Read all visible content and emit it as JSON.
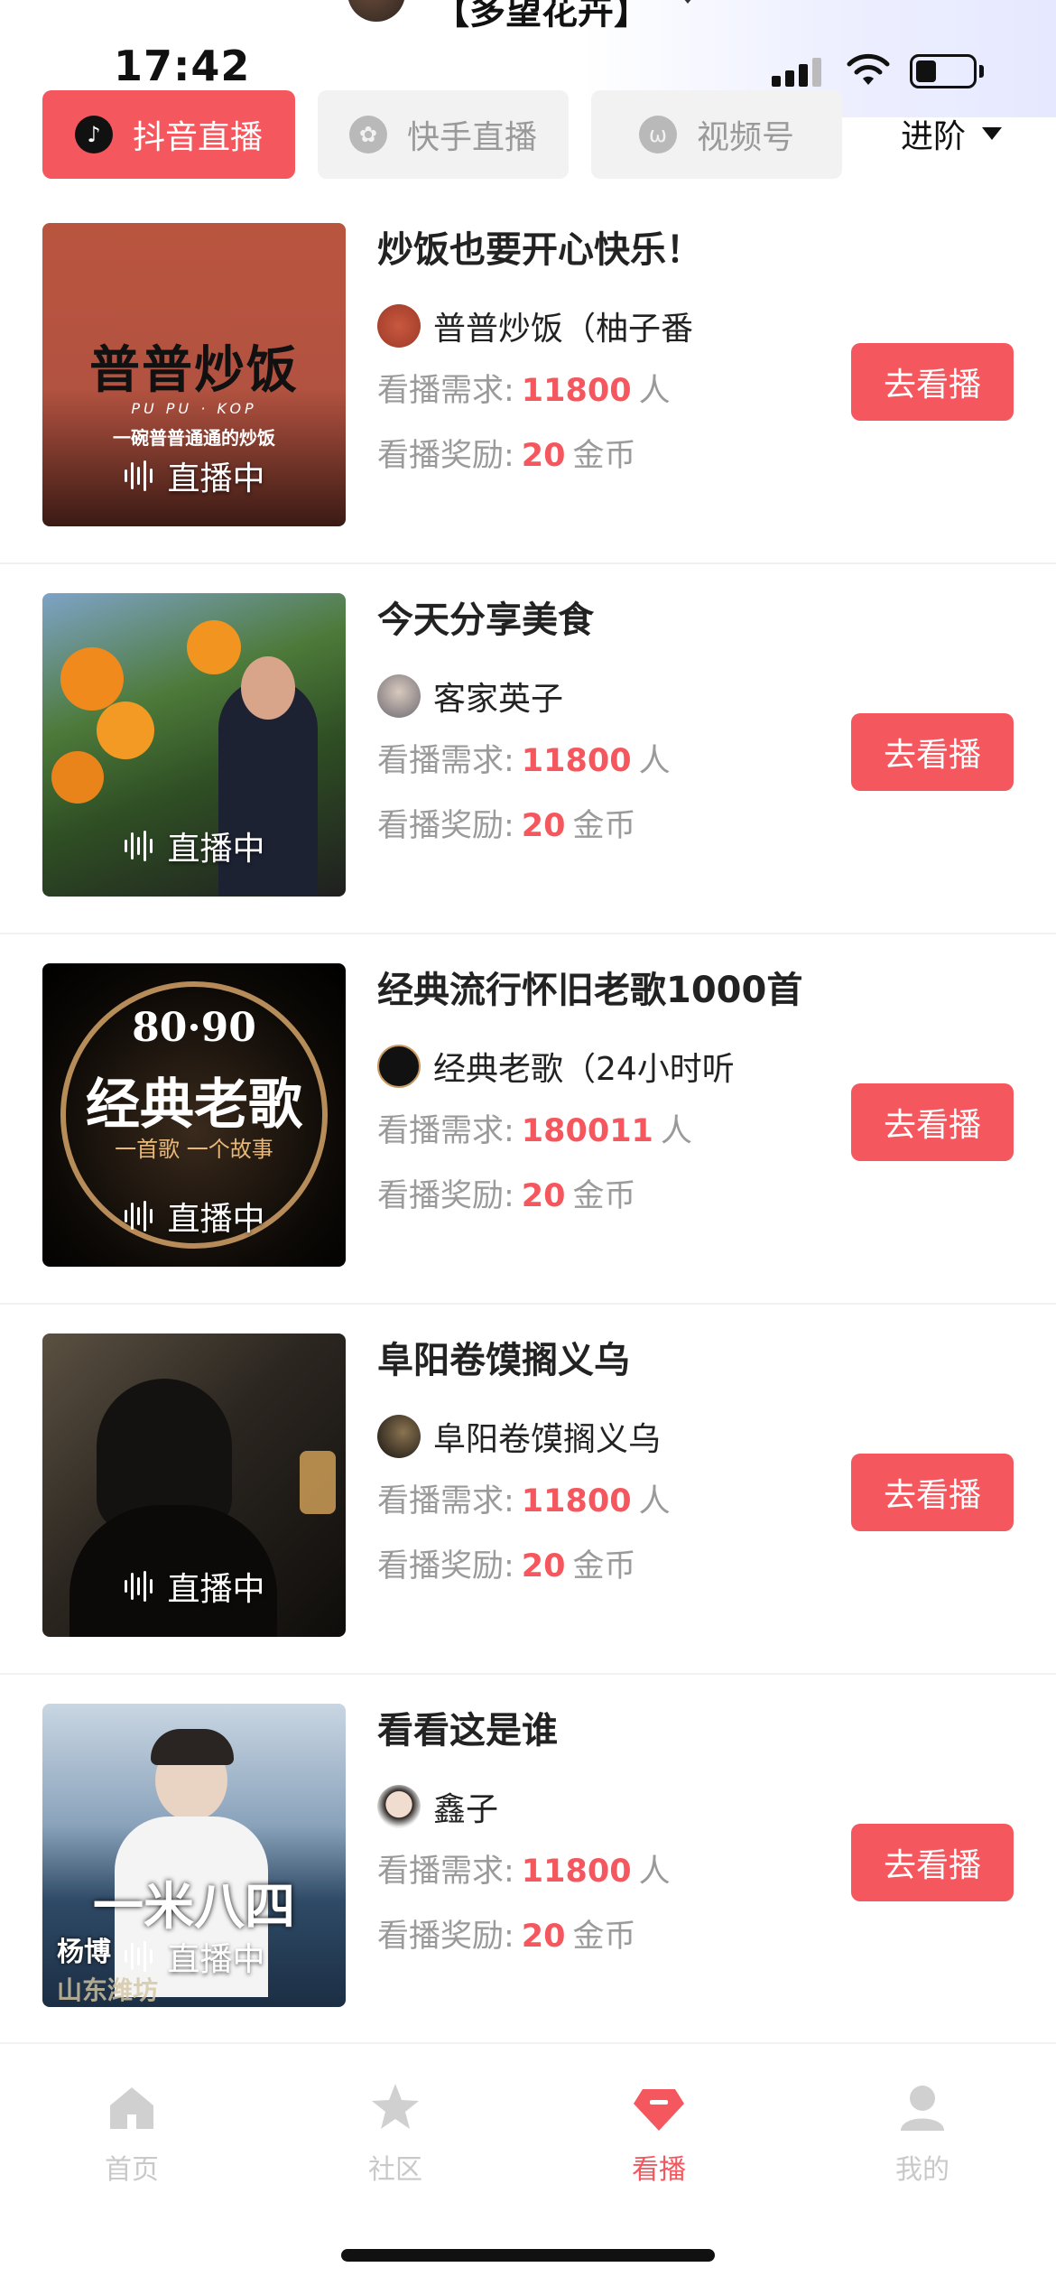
{
  "header": {
    "title": "【多望花卉】"
  },
  "status_bar": {
    "time": "17:42"
  },
  "tabs": [
    {
      "label": "抖音直播",
      "icon": "douyin-icon",
      "active": true
    },
    {
      "label": "快手直播",
      "icon": "kuaishou-icon",
      "active": false
    },
    {
      "label": "视频号",
      "icon": "channels-icon",
      "active": false
    }
  ],
  "advanced": {
    "label": "进阶"
  },
  "common": {
    "live_label": "直播中",
    "demand_label": "看播需求:",
    "reward_label": "看播奖励:",
    "people_unit": "人",
    "coin_unit": "金币",
    "watch_button": "去看播"
  },
  "cards": [
    {
      "title": "炒饭也要开心快乐！",
      "host": "普普炒饭（柚子番",
      "demand": "11800",
      "reward": "20",
      "thumb_text": "普普炒饭",
      "thumb_sub": "PU PU · KOP",
      "thumb_sub2": "一碗普普通通的炒饭"
    },
    {
      "title": "今天分享美食",
      "host": "客家英子",
      "demand": "11800",
      "reward": "20"
    },
    {
      "title": "经典流行怀旧老歌1000首",
      "host": "经典老歌（24小时听",
      "demand": "180011",
      "reward": "20",
      "thumb_text_top": "80·90",
      "thumb_text": "经典老歌",
      "thumb_sub": "一首歌 一个故事"
    },
    {
      "title": "阜阳卷馍搁义乌",
      "host": "阜阳卷馍搁义乌",
      "demand": "11800",
      "reward": "20"
    },
    {
      "title": "看看这是谁",
      "host": "鑫子",
      "demand": "11800",
      "reward": "20",
      "thumb_text": "一米八四",
      "thumb_sub": "杨博",
      "thumb_sub2": "山东潍坊"
    }
  ],
  "bottom_nav": [
    {
      "label": "首页",
      "icon": "home-icon",
      "active": false
    },
    {
      "label": "社区",
      "icon": "star-icon",
      "active": false
    },
    {
      "label": "看播",
      "icon": "watch-gem-icon",
      "active": true
    },
    {
      "label": "我的",
      "icon": "profile-icon",
      "active": false
    }
  ],
  "colors": {
    "accent": "#f4575d",
    "muted": "#9a9a9a",
    "tab_bg": "#f2f2f2"
  }
}
